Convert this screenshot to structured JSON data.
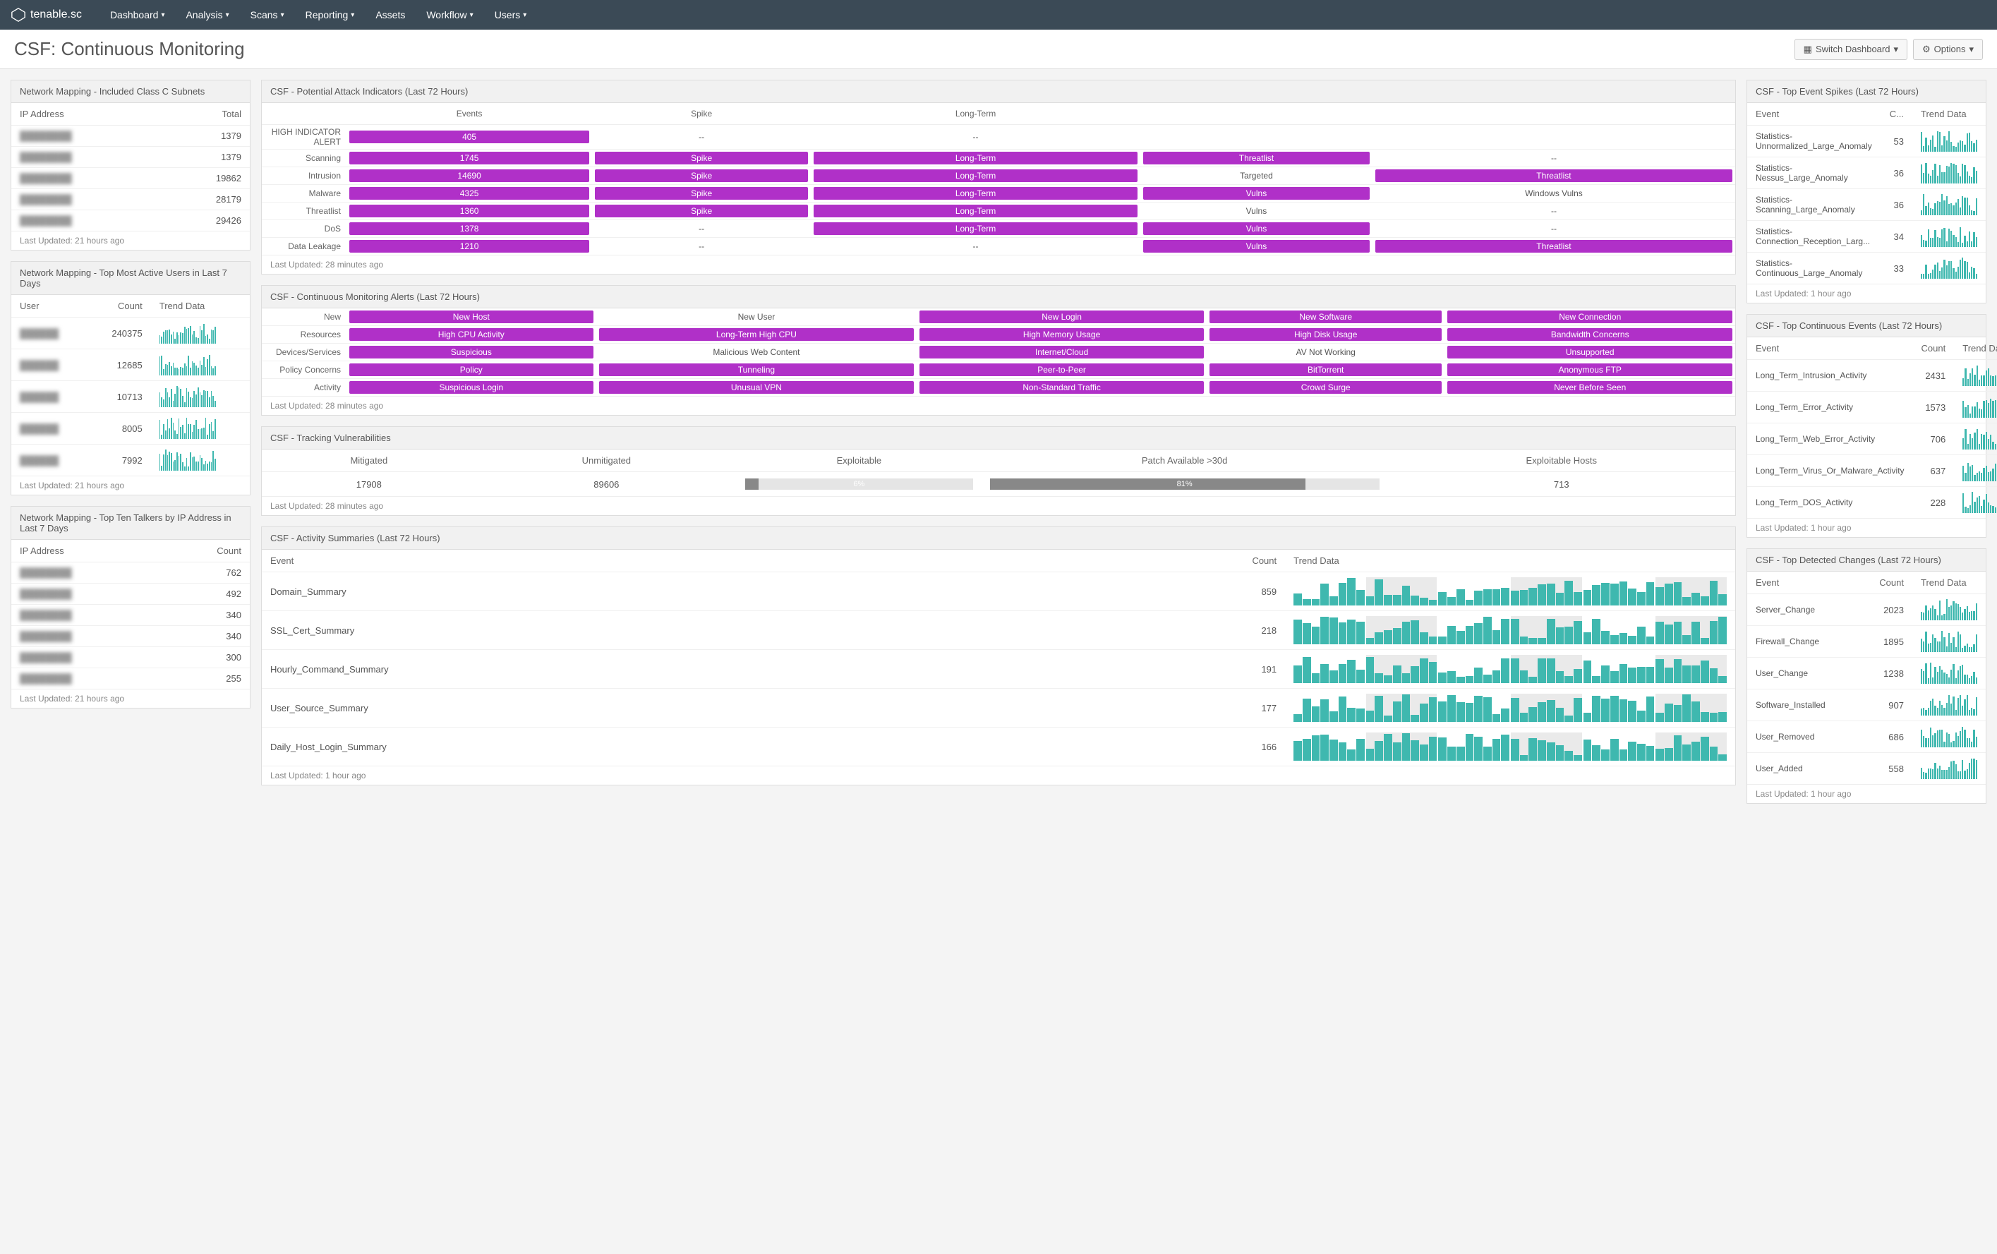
{
  "brand": "tenable.sc",
  "nav": [
    "Dashboard",
    "Analysis",
    "Scans",
    "Reporting",
    "Assets",
    "Workflow",
    "Users"
  ],
  "nav_dropdown": [
    true,
    true,
    true,
    true,
    false,
    true,
    true
  ],
  "page_title": "CSF: Continuous Monitoring",
  "switch_dashboard": "Switch Dashboard",
  "options": "Options",
  "panels": {
    "subnets": {
      "title": "Network Mapping - Included Class C Subnets",
      "cols": [
        "IP Address",
        "Total"
      ],
      "rows": [
        {
          "ip": "—",
          "total": 1379
        },
        {
          "ip": "—",
          "total": 1379
        },
        {
          "ip": "—",
          "total": 19862
        },
        {
          "ip": "—",
          "total": 28179
        },
        {
          "ip": "—",
          "total": 29426
        }
      ],
      "updated": "Last Updated: 21 hours ago"
    },
    "active_users": {
      "title": "Network Mapping - Top Most Active Users in Last 7 Days",
      "cols": [
        "User",
        "Count",
        "Trend Data"
      ],
      "rows": [
        {
          "user": "—",
          "count": 240375
        },
        {
          "user": "—",
          "count": 12685
        },
        {
          "user": "—",
          "count": 10713
        },
        {
          "user": "—",
          "count": 8005
        },
        {
          "user": "—",
          "count": 7992
        }
      ],
      "updated": "Last Updated: 21 hours ago"
    },
    "talkers": {
      "title": "Network Mapping - Top Ten Talkers by IP Address in Last 7 Days",
      "cols": [
        "IP Address",
        "Count"
      ],
      "rows": [
        {
          "ip": "—",
          "count": 762
        },
        {
          "ip": "—",
          "count": 492
        },
        {
          "ip": "—",
          "count": 340
        },
        {
          "ip": "—",
          "count": 340
        },
        {
          "ip": "—",
          "count": 300
        },
        {
          "ip": "—",
          "count": 255
        }
      ],
      "updated": "Last Updated: 21 hours ago"
    },
    "attack": {
      "title": "CSF - Potential Attack Indicators (Last 72 Hours)",
      "cols": [
        "",
        "Events",
        "Spike",
        "Long-Term",
        "",
        ""
      ],
      "rows": [
        {
          "label": "HIGH INDICATOR ALERT",
          "cells": [
            {
              "t": "405",
              "p": 1
            },
            {
              "t": "--"
            },
            {
              "t": "--"
            },
            {
              "t": ""
            },
            {
              "t": ""
            }
          ]
        },
        {
          "label": "Scanning",
          "cells": [
            {
              "t": "1745",
              "p": 1
            },
            {
              "t": "Spike",
              "p": 1
            },
            {
              "t": "Long-Term",
              "p": 1
            },
            {
              "t": "Threatlist",
              "p": 1
            },
            {
              "t": "--"
            }
          ]
        },
        {
          "label": "Intrusion",
          "cells": [
            {
              "t": "14690",
              "p": 1
            },
            {
              "t": "Spike",
              "p": 1
            },
            {
              "t": "Long-Term",
              "p": 1
            },
            {
              "t": "Targeted"
            },
            {
              "t": "Threatlist",
              "p": 1
            }
          ]
        },
        {
          "label": "Malware",
          "cells": [
            {
              "t": "4325",
              "p": 1
            },
            {
              "t": "Spike",
              "p": 1
            },
            {
              "t": "Long-Term",
              "p": 1
            },
            {
              "t": "Vulns",
              "p": 1
            },
            {
              "t": "Windows Vulns"
            }
          ]
        },
        {
          "label": "Threatlist",
          "cells": [
            {
              "t": "1360",
              "p": 1
            },
            {
              "t": "Spike",
              "p": 1
            },
            {
              "t": "Long-Term",
              "p": 1
            },
            {
              "t": "Vulns"
            },
            {
              "t": "--"
            }
          ]
        },
        {
          "label": "DoS",
          "cells": [
            {
              "t": "1378",
              "p": 1
            },
            {
              "t": "--"
            },
            {
              "t": "Long-Term",
              "p": 1
            },
            {
              "t": "Vulns",
              "p": 1
            },
            {
              "t": "--"
            }
          ]
        },
        {
          "label": "Data Leakage",
          "cells": [
            {
              "t": "1210",
              "p": 1
            },
            {
              "t": "--"
            },
            {
              "t": "--"
            },
            {
              "t": "Vulns",
              "p": 1
            },
            {
              "t": "Threatlist",
              "p": 1
            }
          ]
        }
      ],
      "updated": "Last Updated: 28 minutes ago"
    },
    "alerts": {
      "title": "CSF - Continuous Monitoring Alerts (Last 72 Hours)",
      "rows": [
        {
          "label": "New",
          "cells": [
            {
              "t": "New Host",
              "p": 1
            },
            {
              "t": "New User"
            },
            {
              "t": "New Login",
              "p": 1
            },
            {
              "t": "New Software",
              "p": 1
            },
            {
              "t": "New Connection",
              "p": 1
            }
          ]
        },
        {
          "label": "Resources",
          "cells": [
            {
              "t": "High CPU Activity",
              "p": 1
            },
            {
              "t": "Long-Term High CPU",
              "p": 1
            },
            {
              "t": "High Memory Usage",
              "p": 1
            },
            {
              "t": "High Disk Usage",
              "p": 1
            },
            {
              "t": "Bandwidth Concerns",
              "p": 1
            }
          ]
        },
        {
          "label": "Devices/Services",
          "cells": [
            {
              "t": "Suspicious",
              "p": 1
            },
            {
              "t": "Malicious Web Content"
            },
            {
              "t": "Internet/Cloud",
              "p": 1
            },
            {
              "t": "AV Not Working"
            },
            {
              "t": "Unsupported",
              "p": 1
            }
          ]
        },
        {
          "label": "Policy Concerns",
          "cells": [
            {
              "t": "Policy",
              "p": 1
            },
            {
              "t": "Tunneling",
              "p": 1
            },
            {
              "t": "Peer-to-Peer",
              "p": 1
            },
            {
              "t": "BitTorrent",
              "p": 1
            },
            {
              "t": "Anonymous FTP",
              "p": 1
            }
          ]
        },
        {
          "label": "Activity",
          "cells": [
            {
              "t": "Suspicious Login",
              "p": 1
            },
            {
              "t": "Unusual VPN",
              "p": 1
            },
            {
              "t": "Non-Standard Traffic",
              "p": 1
            },
            {
              "t": "Crowd Surge",
              "p": 1
            },
            {
              "t": "Never Before Seen",
              "p": 1
            }
          ]
        }
      ],
      "updated": "Last Updated: 28 minutes ago"
    },
    "vulns": {
      "title": "CSF - Tracking Vulnerabilities",
      "cols": [
        "Mitigated",
        "Unmitigated",
        "Exploitable",
        "Patch Available >30d",
        "Exploitable Hosts"
      ],
      "row": {
        "mitigated": "17908",
        "unmitigated": "89606",
        "exploitable_pct": "6%",
        "exploitable_w": 6,
        "patch_pct": "81%",
        "patch_w": 81,
        "hosts": "713"
      },
      "updated": "Last Updated: 28 minutes ago"
    },
    "activity": {
      "title": "CSF - Activity Summaries (Last 72 Hours)",
      "cols": [
        "Event",
        "Count",
        "Trend Data"
      ],
      "rows": [
        {
          "event": "Domain_Summary",
          "count": 859
        },
        {
          "event": "SSL_Cert_Summary",
          "count": 218
        },
        {
          "event": "Hourly_Command_Summary",
          "count": 191
        },
        {
          "event": "User_Source_Summary",
          "count": 177
        },
        {
          "event": "Daily_Host_Login_Summary",
          "count": 166
        }
      ],
      "updated": "Last Updated: 1 hour ago"
    },
    "spikes": {
      "title": "CSF - Top Event Spikes (Last 72 Hours)",
      "cols": [
        "Event",
        "C...",
        "Trend Data"
      ],
      "rows": [
        {
          "event": "Statistics-Unnormalized_Large_Anomaly",
          "count": 53
        },
        {
          "event": "Statistics-Nessus_Large_Anomaly",
          "count": 36
        },
        {
          "event": "Statistics-Scanning_Large_Anomaly",
          "count": 36
        },
        {
          "event": "Statistics-Connection_Reception_Larg...",
          "count": 34
        },
        {
          "event": "Statistics-Continuous_Large_Anomaly",
          "count": 33
        }
      ],
      "updated": "Last Updated: 1 hour ago"
    },
    "continuous": {
      "title": "CSF - Top Continuous Events (Last 72 Hours)",
      "cols": [
        "Event",
        "Count",
        "Trend Data"
      ],
      "rows": [
        {
          "event": "Long_Term_Intrusion_Activity",
          "count": 2431
        },
        {
          "event": "Long_Term_Error_Activity",
          "count": 1573
        },
        {
          "event": "Long_Term_Web_Error_Activity",
          "count": 706
        },
        {
          "event": "Long_Term_Virus_Or_Malware_Activity",
          "count": 637
        },
        {
          "event": "Long_Term_DOS_Activity",
          "count": 228
        }
      ],
      "updated": "Last Updated: 1 hour ago"
    },
    "changes": {
      "title": "CSF - Top Detected Changes (Last 72 Hours)",
      "cols": [
        "Event",
        "Count",
        "Trend Data"
      ],
      "rows": [
        {
          "event": "Server_Change",
          "count": 2023
        },
        {
          "event": "Firewall_Change",
          "count": 1895
        },
        {
          "event": "User_Change",
          "count": 1238
        },
        {
          "event": "Software_Installed",
          "count": 907
        },
        {
          "event": "User_Removed",
          "count": 686
        },
        {
          "event": "User_Added",
          "count": 558
        }
      ],
      "updated": "Last Updated: 1 hour ago"
    }
  }
}
